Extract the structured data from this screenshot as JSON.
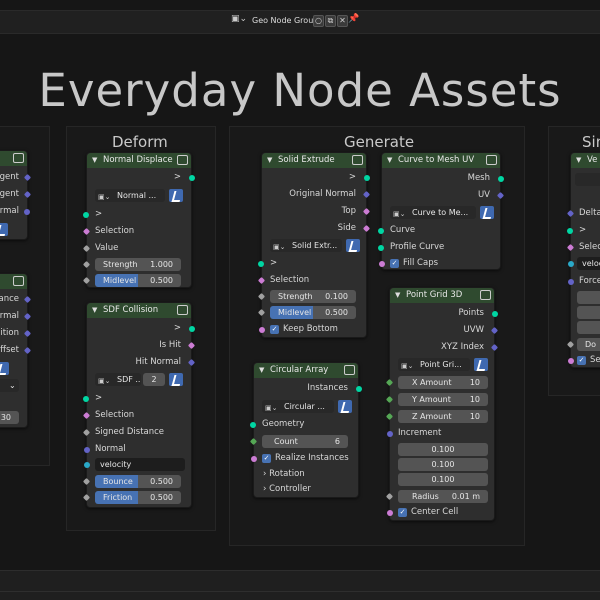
{
  "header": {
    "node_group_name": "Geo Node Groups",
    "pin_icon": "pin-icon",
    "editor_icon": "node-editor-icon"
  },
  "title": "Everyday Node Assets",
  "frames": {
    "deform": "Deform",
    "generate": "Generate",
    "left_partial": "",
    "right_partial": "Sim"
  },
  "left_partial_node": {
    "rows1": [
      "gent",
      "gent",
      "rmal"
    ],
    "rows2": [
      "ance",
      "rmal",
      "ition",
      "ffset"
    ],
    "value": "30"
  },
  "normal_displace": {
    "title": "Normal Displace",
    "out": ">",
    "dropdown": "Normal ...",
    "in_arrow": ">",
    "selection": "Selection",
    "value_label": "Value",
    "strength_label": "Strength",
    "strength_value": "1.000",
    "midlevel_label": "Midlevel",
    "midlevel_value": "0.500"
  },
  "sdf_collision": {
    "title": "SDF Collision",
    "out": ">",
    "is_hit": "Is Hit",
    "hit_normal": "Hit Normal",
    "dropdown": "SDF ...",
    "count": "2",
    "in_arrow": ">",
    "selection": "Selection",
    "signed_distance": "Signed Distance",
    "normal": "Normal",
    "velocity": "velocity",
    "bounce_label": "Bounce",
    "bounce_value": "0.500",
    "friction_label": "Friction",
    "friction_value": "0.500"
  },
  "solid_extrude": {
    "title": "Solid Extrude",
    "out": ">",
    "original_normal": "Original Normal",
    "top": "Top",
    "side": "Side",
    "dropdown": "Solid Extr...",
    "in_arrow": ">",
    "selection": "Selection",
    "strength_label": "Strength",
    "strength_value": "0.100",
    "midlevel_label": "Midlevel",
    "midlevel_value": "0.500",
    "keep_bottom": "Keep Bottom"
  },
  "curve_to_mesh": {
    "title": "Curve to Mesh UV",
    "mesh": "Mesh",
    "uv": "UV",
    "dropdown": "Curve to Me...",
    "curve": "Curve",
    "profile_curve": "Profile Curve",
    "fill_caps": "Fill Caps"
  },
  "circular_array": {
    "title": "Circular Array",
    "instances": "Instances",
    "dropdown": "Circular ...",
    "geometry": "Geometry",
    "count_label": "Count",
    "count_value": "6",
    "realize": "Realize Instances",
    "rotation": "Rotation",
    "controller": "Controller"
  },
  "point_grid": {
    "title": "Point Grid 3D",
    "points": "Points",
    "uvw": "UVW",
    "xyz_index": "XYZ Index",
    "dropdown": "Point Gri...",
    "x_label": "X Amount",
    "x_value": "10",
    "y_label": "Y Amount",
    "y_value": "10",
    "z_label": "Z Amount",
    "z_value": "10",
    "increment": "Increment",
    "inc_x": "0.100",
    "inc_y": "0.100",
    "inc_z": "0.100",
    "radius_label": "Radius",
    "radius_value": "0.01 m",
    "center_cell": "Center Cell"
  },
  "right_partial_node": {
    "title": "Ve",
    "delta": "Delta",
    "arrow": ">",
    "selec": "Selec",
    "velo": "veloc",
    "force": "Force",
    "do": "Do",
    "se": "Se"
  }
}
